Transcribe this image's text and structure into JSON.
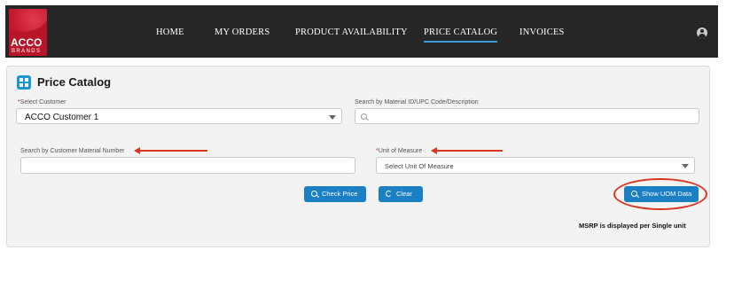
{
  "brand": {
    "logo_word": "ACCO",
    "logo_sub": "BRANDS"
  },
  "nav": {
    "items": [
      {
        "label": "HOME"
      },
      {
        "label": "MY ORDERS"
      },
      {
        "label": "PRODUCT AVAILABILITY"
      },
      {
        "label": "PRICE CATALOG",
        "active": true
      },
      {
        "label": "INVOICES"
      }
    ],
    "user_icon": "user-avatar-icon"
  },
  "page": {
    "title": "Price Catalog",
    "title_icon": "grid-icon"
  },
  "form": {
    "customer": {
      "label": "Select Customer",
      "required": "*",
      "value": "ACCO Customer 1"
    },
    "material_search": {
      "label": "Search by Material ID/UPC Code/Description",
      "value": ""
    },
    "customer_material": {
      "label": "Search by Customer Material Number",
      "value": ""
    },
    "uom": {
      "label": "Unit of Measure",
      "required": "*",
      "value": "Select Unit Of Measure"
    }
  },
  "actions": {
    "check_price": "Check Price",
    "clear": "Clear",
    "show_uom": "Show UOM Data"
  },
  "note": "MSRP is displayed per Single unit",
  "annotation_color": "#d9351f"
}
